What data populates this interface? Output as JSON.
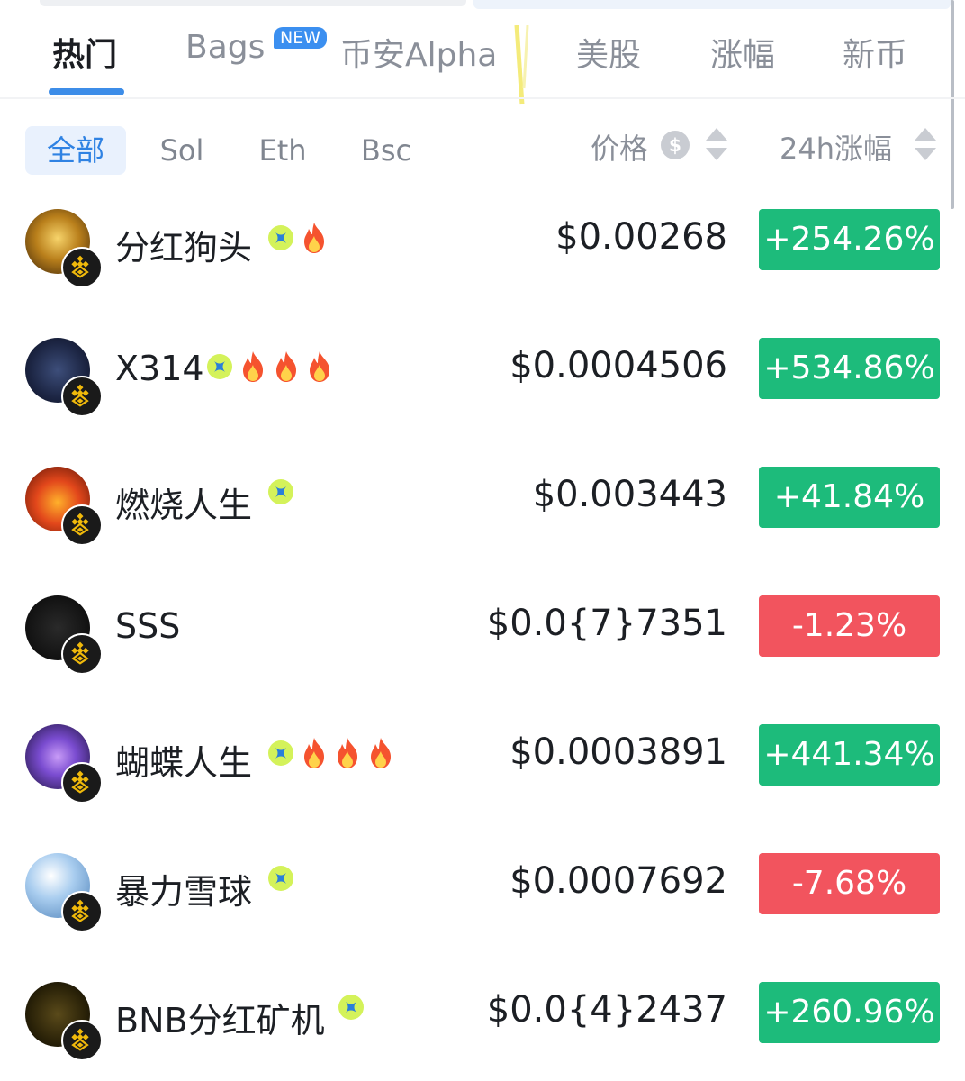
{
  "tabs": [
    {
      "label": "热门",
      "active": true
    },
    {
      "label": "Bags",
      "badge": "NEW"
    },
    {
      "label": "币安Alpha"
    },
    {
      "label": "美股"
    },
    {
      "label": "涨幅"
    },
    {
      "label": "新币"
    }
  ],
  "filters": [
    {
      "label": "全部",
      "active": true
    },
    {
      "label": "Sol"
    },
    {
      "label": "Eth"
    },
    {
      "label": "Bsc"
    }
  ],
  "sort": {
    "price_label": "价格",
    "price_icon": "$",
    "change_label": "24h涨幅"
  },
  "colors": {
    "accent": "#3d8de8",
    "up": "#1dbb7b",
    "down": "#f2545e"
  },
  "tokens": [
    {
      "name": "分红狗头",
      "price": "$0.00268",
      "change": "+254.26%",
      "direction": "up",
      "fires": 1
    },
    {
      "name": "X314",
      "price": "$0.0004506",
      "change": "+534.86%",
      "direction": "up",
      "fires": 3
    },
    {
      "name": "燃烧人生",
      "price": "$0.003443",
      "change": "+41.84%",
      "direction": "up",
      "fires": 0
    },
    {
      "name": "SSS",
      "price": "$0.0{7}7351",
      "change": "-1.23%",
      "direction": "down",
      "fires": 0,
      "no_tag": true
    },
    {
      "name": "蝴蝶人生",
      "price": "$0.0003891",
      "change": "+441.34%",
      "direction": "up",
      "fires": 3
    },
    {
      "name": "暴力雪球",
      "price": "$0.0007692",
      "change": "-7.68%",
      "direction": "down",
      "fires": 0
    },
    {
      "name": "BNB分红矿机",
      "price": "$0.0{4}2437",
      "change": "+260.96%",
      "direction": "up",
      "fires": 0
    }
  ]
}
